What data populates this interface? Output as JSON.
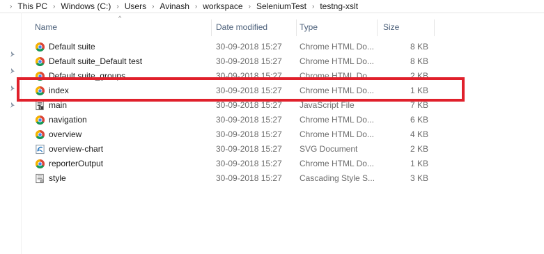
{
  "breadcrumb": [
    "This PC",
    "Windows (C:)",
    "Users",
    "Avinash",
    "workspace",
    "SeleniumTest",
    "testng-xslt"
  ],
  "columns": {
    "name": "Name",
    "date": "Date modified",
    "type": "Type",
    "size": "Size"
  },
  "files": [
    {
      "name": "Default suite",
      "date": "30-09-2018 15:27",
      "type": "Chrome HTML Do...",
      "size": "8 KB",
      "icon": "chrome-icon"
    },
    {
      "name": "Default suite_Default test",
      "date": "30-09-2018 15:27",
      "type": "Chrome HTML Do...",
      "size": "8 KB",
      "icon": "chrome-icon"
    },
    {
      "name": "Default suite_groups",
      "date": "30-09-2018 15:27",
      "type": "Chrome HTML Do...",
      "size": "2 KB",
      "icon": "chrome-icon"
    },
    {
      "name": "index",
      "date": "30-09-2018 15:27",
      "type": "Chrome HTML Do...",
      "size": "1 KB",
      "icon": "chrome-icon"
    },
    {
      "name": "main",
      "date": "30-09-2018 15:27",
      "type": "JavaScript File",
      "size": "7 KB",
      "icon": "script-file-icon"
    },
    {
      "name": "navigation",
      "date": "30-09-2018 15:27",
      "type": "Chrome HTML Do...",
      "size": "6 KB",
      "icon": "chrome-icon"
    },
    {
      "name": "overview",
      "date": "30-09-2018 15:27",
      "type": "Chrome HTML Do...",
      "size": "4 KB",
      "icon": "chrome-icon"
    },
    {
      "name": "overview-chart",
      "date": "30-09-2018 15:27",
      "type": "SVG Document",
      "size": "2 KB",
      "icon": "svg-document-icon"
    },
    {
      "name": "reporterOutput",
      "date": "30-09-2018 15:27",
      "type": "Chrome HTML Do...",
      "size": "1 KB",
      "icon": "chrome-icon"
    },
    {
      "name": "style",
      "date": "30-09-2018 15:27",
      "type": "Cascading Style S...",
      "size": "3 KB",
      "icon": "stylesheet-file-icon"
    }
  ],
  "highlight_color": "#e0202b"
}
